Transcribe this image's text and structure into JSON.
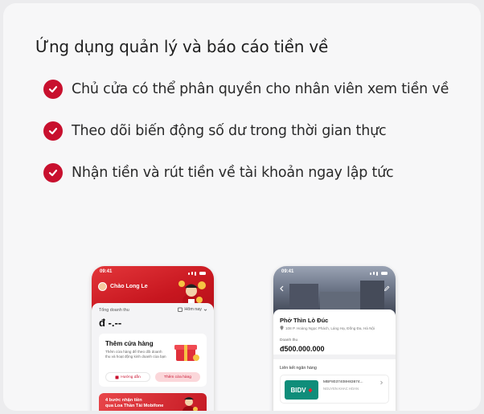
{
  "title": "Ứng dụng quản lý và báo cáo tiền về",
  "features": [
    "Chủ cửa có thể phân quyền cho nhân viên xem tiền về",
    "Theo dõi biến động số dư trong thời gian thực",
    "Nhận tiền và rút tiền về tài khoản ngay lập tức"
  ],
  "phone1": {
    "time": "09:41",
    "greeting": "Chào Long Le",
    "revenue_label": "Tổng doanh thu",
    "date_filter": "Hôm nay",
    "revenue_value": "đ -.--",
    "store_card": {
      "title": "Thêm cửa hàng",
      "description": "Thêm cửa hàng để theo dõi doanh thu và hoạt động kinh doanh của bạn",
      "guide_button": "Hướng dẫn",
      "add_button": "Thêm cửa hàng"
    },
    "promo_line1": "4 bước nhận tiền",
    "promo_line2": "qua Loa Thần Tài Mobifone"
  },
  "phone2": {
    "time": "09:41",
    "shop_name": "Phở Thìn Lò Đúc",
    "address": "108 P. Hoàng Ngọc Phách, Láng Hạ, Đống Đa, Hà Nội",
    "revenue_label": "Doanh thu",
    "revenue_value": "đ500.000.000",
    "bank_section_label": "Liên kết ngân hàng",
    "bank_logo": "BIDV",
    "account_number": "MBF8037408H83674...",
    "account_name": "NGUYEN KHAC HOAN"
  },
  "colors": {
    "accent": "#c8102e",
    "bank": "#0f8d7a"
  }
}
